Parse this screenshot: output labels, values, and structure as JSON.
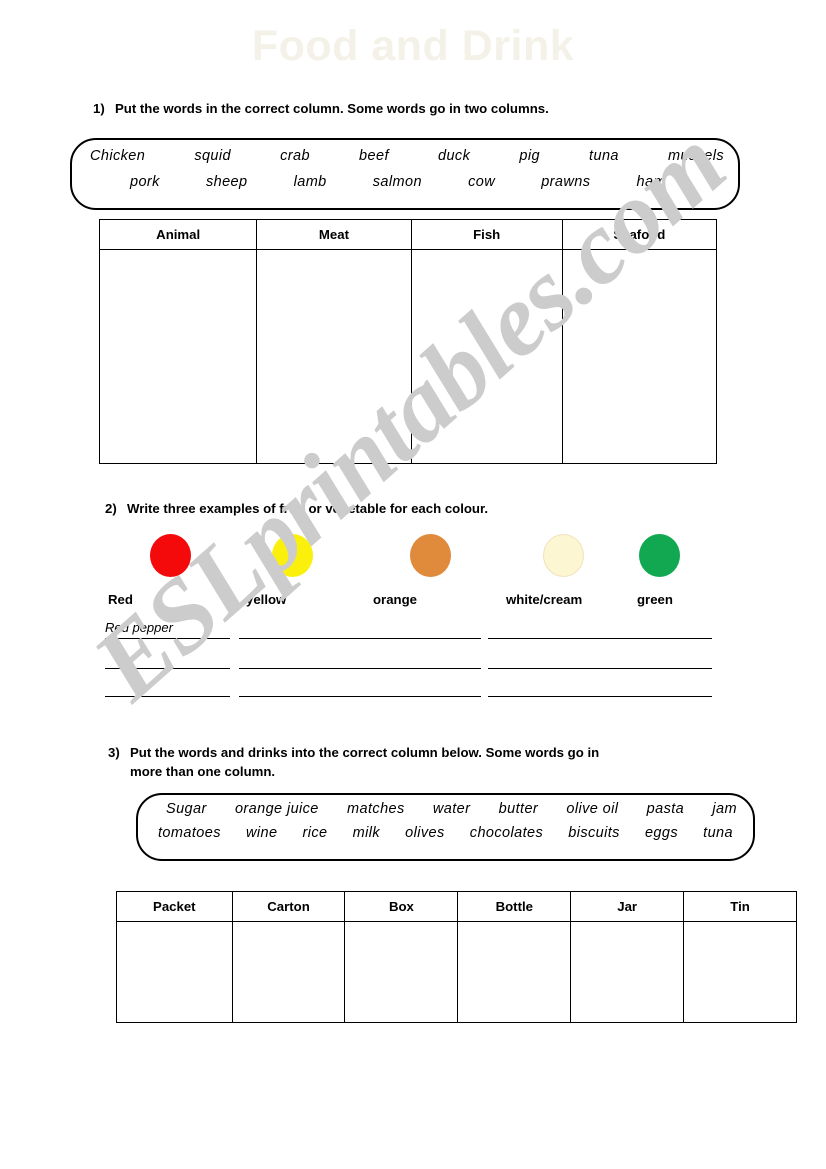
{
  "title": "Food and Drink",
  "watermark": "ESLprintables.com",
  "colors": {
    "title": "#f4f2e8",
    "watermark": "#cccccc",
    "red": "#f40a0a",
    "yellow": "#fbf00c",
    "orange": "#e08a3c",
    "cream": "#fdf6d3",
    "cream_border": "#efe3b8",
    "green": "#12a852",
    "ink": "#000000"
  },
  "exercises": [
    {
      "number": "1)",
      "instruction": "Put the words in the correct column.  Some words go in two columns.",
      "word_bank": {
        "row1": [
          "Chicken",
          "squid",
          "crab",
          "beef",
          "duck",
          "pig",
          "tuna",
          "mussels"
        ],
        "row2": [
          "pork",
          "sheep",
          "lamb",
          "salmon",
          "cow",
          "prawns",
          "ham"
        ]
      },
      "table": {
        "headers": [
          "Animal",
          "Meat",
          "Fish",
          "Seafood"
        ],
        "rows": [
          [
            "",
            "",
            "",
            ""
          ]
        ]
      }
    },
    {
      "number": "2)",
      "instruction": "Write three examples of fruit or vegetable for each colour.",
      "colours": [
        {
          "label": "Red",
          "swatch": "#f40a0a"
        },
        {
          "label": "yellow",
          "swatch": "#fbf00c"
        },
        {
          "label": "orange",
          "swatch": "#e08a3c"
        },
        {
          "label": "white/cream",
          "swatch": "#fdf6d3"
        },
        {
          "label": "green",
          "swatch": "#12a852"
        }
      ],
      "sample_answer": "Red pepper",
      "line_rows": 3
    },
    {
      "number": "3)",
      "instruction_line1": "Put the words and drinks into the correct column below. Some words go in",
      "instruction_line2": "more than one column.",
      "word_bank": {
        "row1": [
          "Sugar",
          "orange juice",
          "matches",
          "water",
          "butter",
          "olive oil",
          "pasta",
          "jam"
        ],
        "row2": [
          "tomatoes",
          "wine",
          "rice",
          "milk",
          "olives",
          "chocolates",
          "biscuits",
          "eggs",
          "tuna"
        ]
      },
      "table": {
        "headers": [
          "Packet",
          "Carton",
          "Box",
          "Bottle",
          "Jar",
          "Tin"
        ],
        "rows": [
          [
            "",
            "",
            "",
            "",
            "",
            ""
          ]
        ]
      }
    }
  ]
}
